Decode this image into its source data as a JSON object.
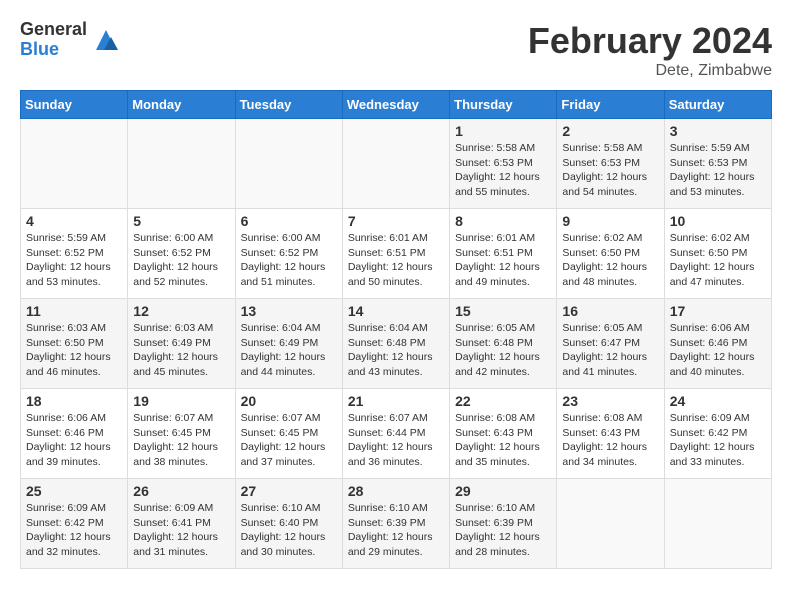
{
  "app": {
    "logo_general": "General",
    "logo_blue": "Blue"
  },
  "header": {
    "month_year": "February 2024",
    "location": "Dete, Zimbabwe"
  },
  "weekdays": [
    "Sunday",
    "Monday",
    "Tuesday",
    "Wednesday",
    "Thursday",
    "Friday",
    "Saturday"
  ],
  "weeks": [
    {
      "days": [
        {
          "number": "",
          "info": "",
          "empty": true
        },
        {
          "number": "",
          "info": "",
          "empty": true
        },
        {
          "number": "",
          "info": "",
          "empty": true
        },
        {
          "number": "",
          "info": "",
          "empty": true
        },
        {
          "number": "1",
          "info": "Sunrise: 5:58 AM\nSunset: 6:53 PM\nDaylight: 12 hours\nand 55 minutes.",
          "empty": false
        },
        {
          "number": "2",
          "info": "Sunrise: 5:58 AM\nSunset: 6:53 PM\nDaylight: 12 hours\nand 54 minutes.",
          "empty": false
        },
        {
          "number": "3",
          "info": "Sunrise: 5:59 AM\nSunset: 6:53 PM\nDaylight: 12 hours\nand 53 minutes.",
          "empty": false
        }
      ]
    },
    {
      "days": [
        {
          "number": "4",
          "info": "Sunrise: 5:59 AM\nSunset: 6:52 PM\nDaylight: 12 hours\nand 53 minutes.",
          "empty": false
        },
        {
          "number": "5",
          "info": "Sunrise: 6:00 AM\nSunset: 6:52 PM\nDaylight: 12 hours\nand 52 minutes.",
          "empty": false
        },
        {
          "number": "6",
          "info": "Sunrise: 6:00 AM\nSunset: 6:52 PM\nDaylight: 12 hours\nand 51 minutes.",
          "empty": false
        },
        {
          "number": "7",
          "info": "Sunrise: 6:01 AM\nSunset: 6:51 PM\nDaylight: 12 hours\nand 50 minutes.",
          "empty": false
        },
        {
          "number": "8",
          "info": "Sunrise: 6:01 AM\nSunset: 6:51 PM\nDaylight: 12 hours\nand 49 minutes.",
          "empty": false
        },
        {
          "number": "9",
          "info": "Sunrise: 6:02 AM\nSunset: 6:50 PM\nDaylight: 12 hours\nand 48 minutes.",
          "empty": false
        },
        {
          "number": "10",
          "info": "Sunrise: 6:02 AM\nSunset: 6:50 PM\nDaylight: 12 hours\nand 47 minutes.",
          "empty": false
        }
      ]
    },
    {
      "days": [
        {
          "number": "11",
          "info": "Sunrise: 6:03 AM\nSunset: 6:50 PM\nDaylight: 12 hours\nand 46 minutes.",
          "empty": false
        },
        {
          "number": "12",
          "info": "Sunrise: 6:03 AM\nSunset: 6:49 PM\nDaylight: 12 hours\nand 45 minutes.",
          "empty": false
        },
        {
          "number": "13",
          "info": "Sunrise: 6:04 AM\nSunset: 6:49 PM\nDaylight: 12 hours\nand 44 minutes.",
          "empty": false
        },
        {
          "number": "14",
          "info": "Sunrise: 6:04 AM\nSunset: 6:48 PM\nDaylight: 12 hours\nand 43 minutes.",
          "empty": false
        },
        {
          "number": "15",
          "info": "Sunrise: 6:05 AM\nSunset: 6:48 PM\nDaylight: 12 hours\nand 42 minutes.",
          "empty": false
        },
        {
          "number": "16",
          "info": "Sunrise: 6:05 AM\nSunset: 6:47 PM\nDaylight: 12 hours\nand 41 minutes.",
          "empty": false
        },
        {
          "number": "17",
          "info": "Sunrise: 6:06 AM\nSunset: 6:46 PM\nDaylight: 12 hours\nand 40 minutes.",
          "empty": false
        }
      ]
    },
    {
      "days": [
        {
          "number": "18",
          "info": "Sunrise: 6:06 AM\nSunset: 6:46 PM\nDaylight: 12 hours\nand 39 minutes.",
          "empty": false
        },
        {
          "number": "19",
          "info": "Sunrise: 6:07 AM\nSunset: 6:45 PM\nDaylight: 12 hours\nand 38 minutes.",
          "empty": false
        },
        {
          "number": "20",
          "info": "Sunrise: 6:07 AM\nSunset: 6:45 PM\nDaylight: 12 hours\nand 37 minutes.",
          "empty": false
        },
        {
          "number": "21",
          "info": "Sunrise: 6:07 AM\nSunset: 6:44 PM\nDaylight: 12 hours\nand 36 minutes.",
          "empty": false
        },
        {
          "number": "22",
          "info": "Sunrise: 6:08 AM\nSunset: 6:43 PM\nDaylight: 12 hours\nand 35 minutes.",
          "empty": false
        },
        {
          "number": "23",
          "info": "Sunrise: 6:08 AM\nSunset: 6:43 PM\nDaylight: 12 hours\nand 34 minutes.",
          "empty": false
        },
        {
          "number": "24",
          "info": "Sunrise: 6:09 AM\nSunset: 6:42 PM\nDaylight: 12 hours\nand 33 minutes.",
          "empty": false
        }
      ]
    },
    {
      "days": [
        {
          "number": "25",
          "info": "Sunrise: 6:09 AM\nSunset: 6:42 PM\nDaylight: 12 hours\nand 32 minutes.",
          "empty": false
        },
        {
          "number": "26",
          "info": "Sunrise: 6:09 AM\nSunset: 6:41 PM\nDaylight: 12 hours\nand 31 minutes.",
          "empty": false
        },
        {
          "number": "27",
          "info": "Sunrise: 6:10 AM\nSunset: 6:40 PM\nDaylight: 12 hours\nand 30 minutes.",
          "empty": false
        },
        {
          "number": "28",
          "info": "Sunrise: 6:10 AM\nSunset: 6:39 PM\nDaylight: 12 hours\nand 29 minutes.",
          "empty": false
        },
        {
          "number": "29",
          "info": "Sunrise: 6:10 AM\nSunset: 6:39 PM\nDaylight: 12 hours\nand 28 minutes.",
          "empty": false
        },
        {
          "number": "",
          "info": "",
          "empty": true
        },
        {
          "number": "",
          "info": "",
          "empty": true
        }
      ]
    }
  ]
}
